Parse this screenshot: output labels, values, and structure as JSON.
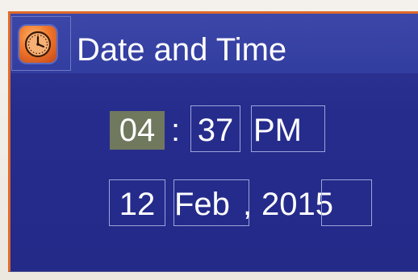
{
  "dialog": {
    "title": "Date and Time",
    "app_icon": "clock-icon"
  },
  "time": {
    "hour": "04",
    "hour_separator": ":",
    "minute": "37",
    "meridiem": "PM",
    "selected_field": "hour"
  },
  "date": {
    "day": "12",
    "month": "Feb",
    "separator": ",",
    "year": "2015"
  },
  "colors": {
    "panel_bg": "#2b3392",
    "header_bg": "#3a45a6",
    "accent_border": "#e06a28",
    "selection_bg": "#70785e",
    "field_border": "#9ba4dc",
    "text": "#ffffff"
  }
}
